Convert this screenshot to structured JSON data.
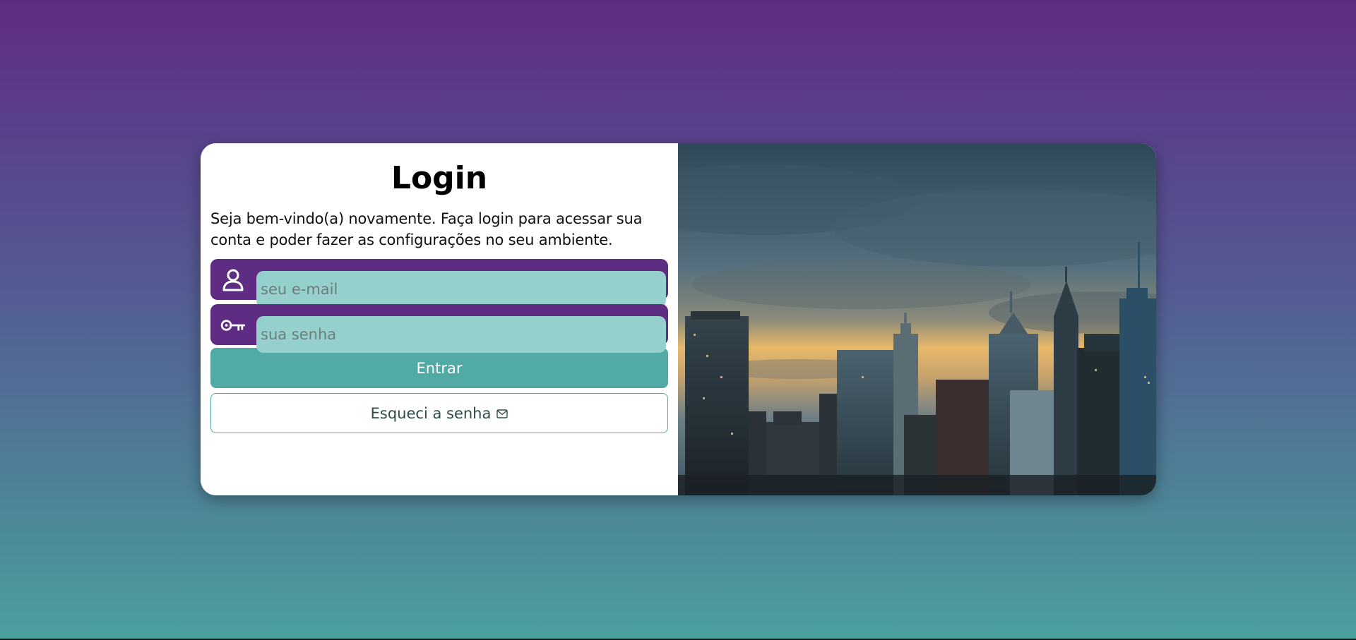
{
  "login": {
    "title": "Login",
    "subtitle": "Seja bem-vindo(a) novamente. Faça login para acessar sua conta e poder fazer as configurações no seu ambiente.",
    "email": {
      "icon": "user-icon",
      "placeholder": "seu e-mail",
      "value": ""
    },
    "password": {
      "icon": "key-icon",
      "placeholder": "sua senha",
      "value": ""
    },
    "submit_label": "Entrar",
    "forgot_label": "Esqueci a senha",
    "forgot_icon": "mail-icon"
  },
  "image": {
    "subject": "city-skyline-photo"
  },
  "colors": {
    "brand_purple": "#5f2c84",
    "accent_teal": "#52aaa6",
    "input_bg": "#96d0cd"
  }
}
